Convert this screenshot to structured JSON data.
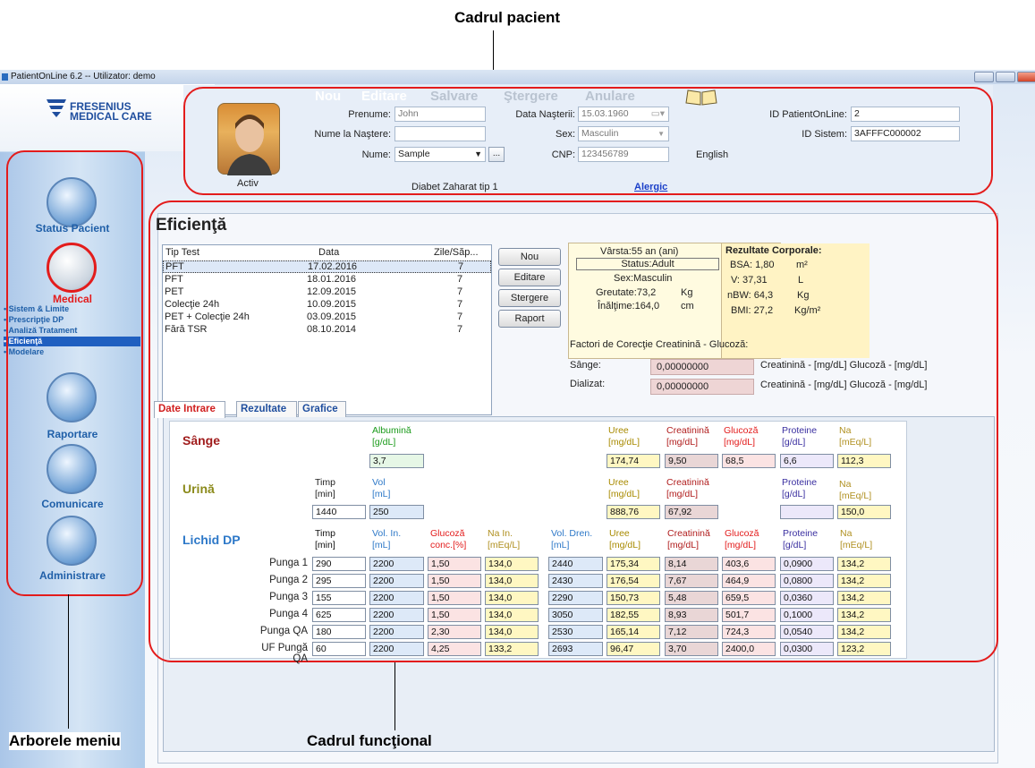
{
  "annotations": {
    "patient_frame": "Cadrul pacient",
    "menu_tree": "Arborele meniu",
    "functional_frame": "Cadrul funcţional"
  },
  "window": {
    "title": "PatientOnLine 6.2  --  Utilizator: demo"
  },
  "logo": {
    "line1": "FRESENIUS",
    "line2": "MEDICAL CARE"
  },
  "sidebar": {
    "items": [
      {
        "label": "Status Pacient",
        "icon": "bed-icon"
      },
      {
        "label": "Medical",
        "icon": "microscope-icon"
      },
      {
        "label": "Raportare",
        "icon": "doctor-icon"
      },
      {
        "label": "Comunicare",
        "icon": "computer-icon"
      },
      {
        "label": "Administrare",
        "icon": "folder-icon"
      }
    ],
    "sub_items": [
      "• Sistem & Limite",
      "• Prescripţie DP",
      "• Analiză Tratament",
      "• Eficienţă",
      "• Modelare"
    ],
    "selected_sub": "Eficienţă"
  },
  "header": {
    "actions": {
      "new": "Nou",
      "edit": "Editare",
      "save": "Salvare",
      "delete": "Ştergere",
      "cancel": "Anulare"
    },
    "patient_status": "Activ",
    "labels": {
      "first_name": "Prenume:",
      "birth_name": "Nume la Naştere:",
      "name": "Nume:",
      "birth_date": "Data Naşterii:",
      "sex": "Sex:",
      "cnp": "CNP:",
      "pol_id": "ID PatientOnLine:",
      "system_id": "ID Sistem:"
    },
    "values": {
      "first_name": "John",
      "birth_name": "",
      "name": "Sample",
      "birth_date": "15.03.1960",
      "sex": "Masculin",
      "cnp": "123456789",
      "language": "English",
      "pol_id": "2",
      "system_id": "3AFFFC000002"
    },
    "diagnosis": "Diabet Zaharat tip 1",
    "allergic_link": "Alergic"
  },
  "main": {
    "title": "Eficienţă",
    "tests_table": {
      "headers": [
        "Tip Test",
        "Data",
        "Zile/Săp..."
      ],
      "rows": [
        {
          "type": "PFT",
          "date": "17.02.2016",
          "days": "7"
        },
        {
          "type": "PFT",
          "date": "18.01.2016",
          "days": "7"
        },
        {
          "type": "PET",
          "date": "12.09.2015",
          "days": "7"
        },
        {
          "type": "Colecţie 24h",
          "date": "10.09.2015",
          "days": "7"
        },
        {
          "type": "PET + Colecţie 24h",
          "date": "03.09.2015",
          "days": "7"
        },
        {
          "type": "Fără TSR",
          "date": "08.10.2014",
          "days": "7"
        }
      ]
    },
    "buttons": {
      "new": "Nou",
      "edit": "Editare",
      "delete": "Stergere",
      "report": "Raport"
    },
    "patient_info": {
      "age": "Vârsta:55 an (ani)",
      "status": "Status:Adult",
      "sex": "Sex:Masculin",
      "weight_label": "Greutate:73,2",
      "weight_unit": "Kg",
      "height_label": "Înălţime:164,0",
      "height_unit": "cm"
    },
    "body_results": {
      "title": "Rezultate Corporale:",
      "bsa": "BSA: 1,80",
      "bsa_unit": "m²",
      "v": "V: 37,31",
      "v_unit": "L",
      "nbw": "nBW: 64,3",
      "nbw_unit": "Kg",
      "bmi": "BMI: 27,2",
      "bmi_unit": "Kg/m²"
    },
    "correction": {
      "title": "Factori de Corecţie Creatinină - Glucoză:",
      "blood_label": "Sânge:",
      "blood_value": "0,00000000",
      "blood_units": "Creatinină - [mg/dL] Glucoză - [mg/dL]",
      "dialysate_label": "Dializat:",
      "dialysate_value": "0,00000000",
      "dialysate_units": "Creatinină - [mg/dL] Glucoză - [mg/dL]"
    },
    "tabs": [
      "Date Intrare",
      "Rezultate",
      "Grafice"
    ],
    "blood": {
      "title": "Sânge",
      "h_alb": "Albumină",
      "u_alb": "[g/dL]",
      "alb": "3,7",
      "h_uree": "Uree",
      "u_uree": "[mg/dL]",
      "uree": "174,74",
      "h_creat": "Creatinină",
      "u_creat": "[mg/dL]",
      "creat": "9,50",
      "h_gluc": "Glucoză",
      "u_gluc": "[mg/dL]",
      "gluc": "68,5",
      "h_prot": "Proteine",
      "u_prot": "[g/dL]",
      "prot": "6,6",
      "h_na": "Na",
      "u_na": "[mEq/L]",
      "na": "112,3"
    },
    "urine": {
      "title": "Urină",
      "h_timp": "Timp",
      "u_timp": "[min]",
      "timp": "1440",
      "h_vol": "Vol",
      "u_vol": "[mL]",
      "vol": "250",
      "h_uree": "Uree",
      "u_uree": "[mg/dL]",
      "uree": "888,76",
      "h_creat": "Creatinină",
      "u_creat": "[mg/dL]",
      "creat": "67,92",
      "h_prot": "Proteine",
      "u_prot": "[g/dL]",
      "prot": "",
      "h_na": "Na",
      "u_na": "[mEq/L]",
      "na": "150,0"
    },
    "dp": {
      "title": "Lichid DP",
      "headers": [
        [
          "Timp",
          "[min]"
        ],
        [
          "Vol. In.",
          "[mL]"
        ],
        [
          "Glucoză",
          "conc.[%]"
        ],
        [
          "Na In.",
          "[mEq/L]"
        ],
        [
          "Vol. Dren.",
          "[mL]"
        ],
        [
          "Uree",
          "[mg/dL]"
        ],
        [
          "Creatinină",
          "[mg/dL]"
        ],
        [
          "Glucoză",
          "[mg/dL]"
        ],
        [
          "Proteine",
          "[g/dL]"
        ],
        [
          "Na",
          "[mEq/L]"
        ]
      ],
      "rows": [
        {
          "label": "Punga 1",
          "v": [
            "290",
            "2200",
            "1,50",
            "134,0",
            "2440",
            "175,34",
            "8,14",
            "403,6",
            "0,0900",
            "134,2"
          ]
        },
        {
          "label": "Punga 2",
          "v": [
            "295",
            "2200",
            "1,50",
            "134,0",
            "2430",
            "176,54",
            "7,67",
            "464,9",
            "0,0800",
            "134,2"
          ]
        },
        {
          "label": "Punga 3",
          "v": [
            "155",
            "2200",
            "1,50",
            "134,0",
            "2290",
            "150,73",
            "5,48",
            "659,5",
            "0,0360",
            "134,2"
          ]
        },
        {
          "label": "Punga 4",
          "v": [
            "625",
            "2200",
            "1,50",
            "134,0",
            "3050",
            "182,55",
            "8,93",
            "501,7",
            "0,1000",
            "134,2"
          ]
        },
        {
          "label": "Punga QA",
          "v": [
            "180",
            "2200",
            "2,30",
            "134,0",
            "2530",
            "165,14",
            "7,12",
            "724,3",
            "0,0540",
            "134,2"
          ]
        },
        {
          "label": "UF Pungă QA",
          "v": [
            "60",
            "2200",
            "4,25",
            "133,2",
            "2693",
            "96,47",
            "3,70",
            "2400,0",
            "0,0300",
            "123,2"
          ]
        }
      ]
    }
  },
  "colors": {
    "accent_red": "#e31c1c",
    "brand_blue": "#1f4e9e",
    "selected": "#1f5fc0"
  }
}
